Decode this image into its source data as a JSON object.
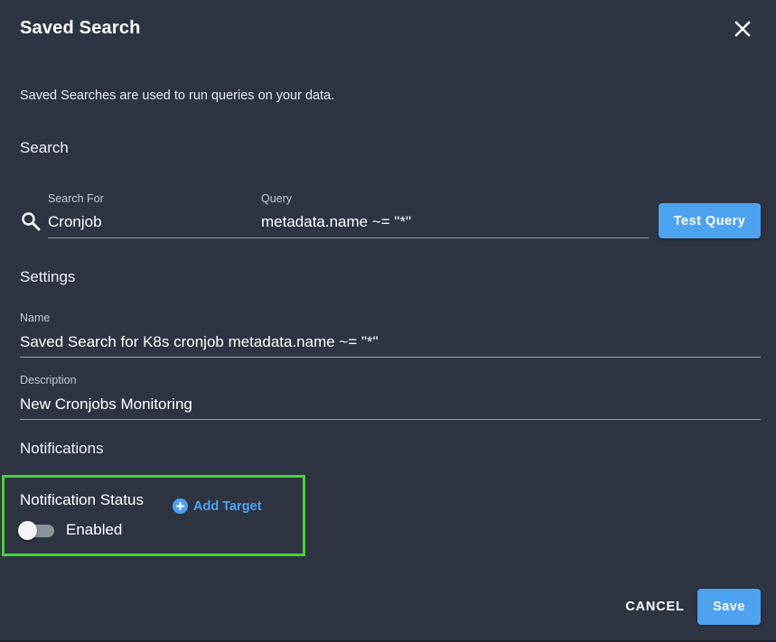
{
  "dialog": {
    "title": "Saved Search",
    "intro": "Saved Searches are used to run queries on your data."
  },
  "search": {
    "heading": "Search",
    "search_for_label": "Search For",
    "search_for_value": "Cronjob",
    "query_label": "Query",
    "query_value": "metadata.name ~= \"*\"",
    "test_query_label": "Test Query"
  },
  "settings": {
    "heading": "Settings",
    "name_label": "Name",
    "name_value": "Saved Search for K8s cronjob metadata.name ~= \"*\"",
    "description_label": "Description",
    "description_value": "New Cronjobs Monitoring"
  },
  "notifications": {
    "heading": "Notifications",
    "status_label": "Notification Status",
    "toggle_label": "Enabled",
    "toggle_on": false,
    "add_target_label": "Add Target"
  },
  "footer": {
    "cancel_label": "CANCEL",
    "save_label": "Save"
  },
  "colors": {
    "background": "#2f3443",
    "accent": "#4da3f0",
    "highlight": "#45d13a"
  },
  "icons": {
    "close": "close-icon",
    "search": "search-icon",
    "add": "plus-circle-icon"
  }
}
